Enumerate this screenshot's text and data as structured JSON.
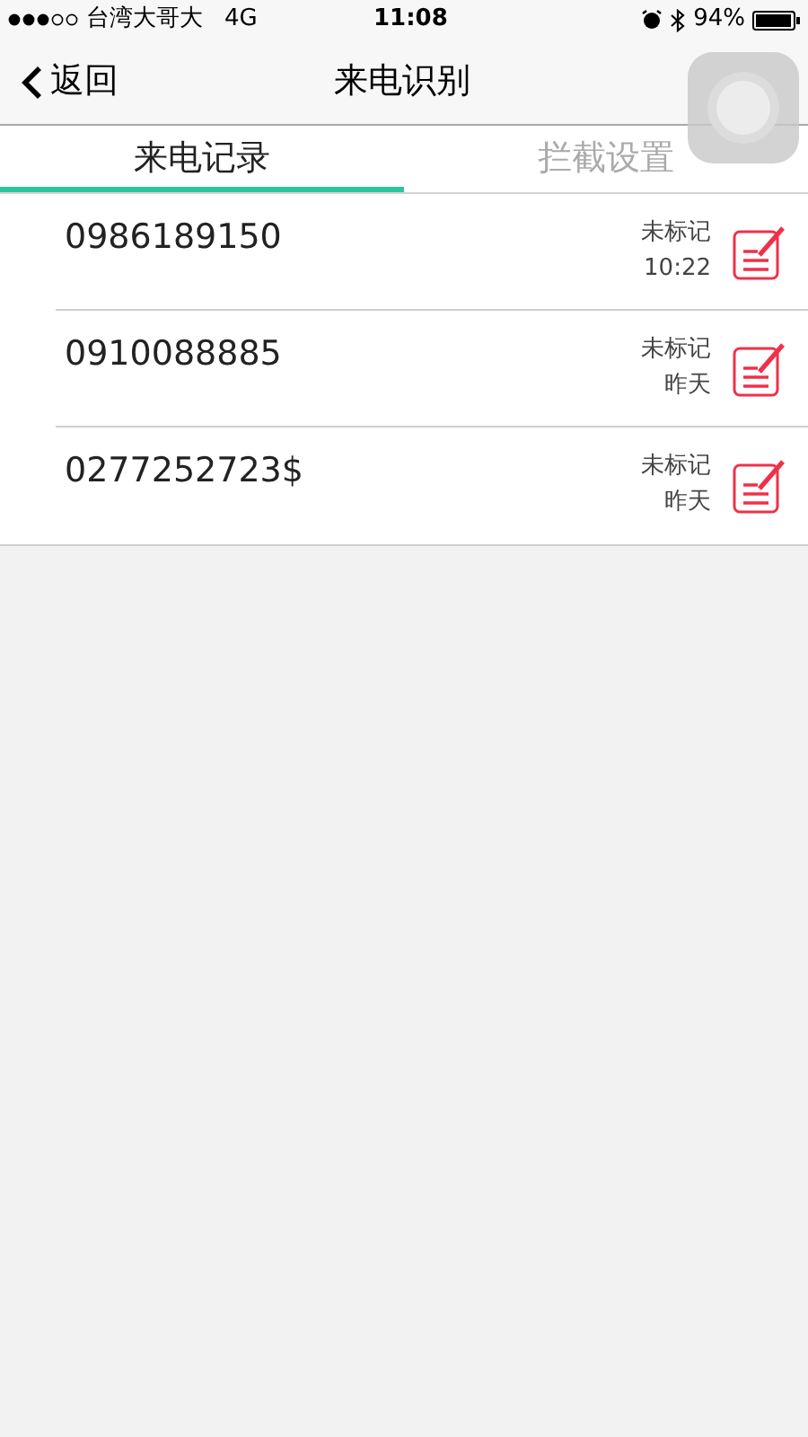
{
  "status_bar": {
    "carrier": "台湾大哥大",
    "network": "4G",
    "time": "11:08",
    "battery": "94%"
  },
  "nav": {
    "back": "返回",
    "title": "来电识别"
  },
  "tabs": [
    {
      "label": "来电记录",
      "selected": true
    },
    {
      "label": "拦截设置",
      "selected": false
    }
  ],
  "calls": [
    {
      "number": "0986189150",
      "status": "未标记",
      "time": "10:22"
    },
    {
      "number": "0910088885",
      "status": "未标记",
      "time": "昨天"
    },
    {
      "number": "0277252723$",
      "status": "未标记",
      "time": "昨天"
    }
  ]
}
